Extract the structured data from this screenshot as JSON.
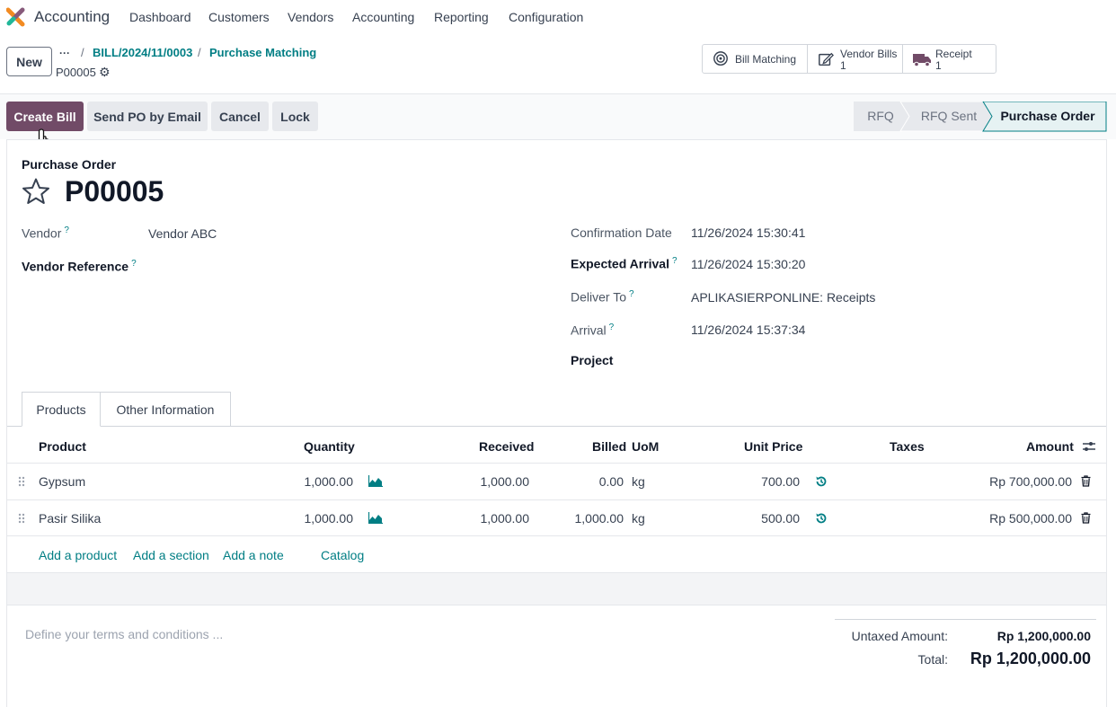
{
  "navbar": {
    "app_name": "Accounting",
    "menu": [
      "Dashboard",
      "Customers",
      "Vendors",
      "Accounting",
      "Reporting",
      "Configuration"
    ]
  },
  "control_panel": {
    "new_label": "New",
    "more_label": "···",
    "breadcrumbs": [
      "BILL/2024/11/0003",
      "Purchase Matching"
    ],
    "record_name": "P00005",
    "smart_buttons": [
      {
        "label": "Bill Matching",
        "value": "",
        "icon": "bullseye-icon"
      },
      {
        "label": "Vendor Bills",
        "value": "1",
        "icon": "pencil-square-icon"
      },
      {
        "label": "Receipt",
        "value": "1",
        "icon": "truck-icon"
      }
    ]
  },
  "actions": {
    "create_bill": "Create Bill",
    "send_po": "Send PO by Email",
    "cancel": "Cancel",
    "lock": "Lock"
  },
  "status_bar": {
    "stages": [
      "RFQ",
      "RFQ Sent",
      "Purchase Order"
    ],
    "active": "Purchase Order"
  },
  "form": {
    "type_label": "Purchase Order",
    "name": "P00005",
    "help_mark": "?",
    "vendor_label": "Vendor",
    "vendor_value": "Vendor ABC",
    "vendor_ref_label": "Vendor Reference",
    "confirmation_date_label": "Confirmation Date",
    "confirmation_date_value": "11/26/2024 15:30:41",
    "expected_arrival_label": "Expected Arrival",
    "expected_arrival_value": "11/26/2024 15:30:20",
    "deliver_to_label": "Deliver To",
    "deliver_to_value": "APLIKASIERPONLINE: Receipts",
    "arrival_label": "Arrival",
    "arrival_value": "11/26/2024 15:37:34",
    "project_label": "Project"
  },
  "tabs": [
    "Products",
    "Other Information"
  ],
  "table": {
    "headers": {
      "product": "Product",
      "quantity": "Quantity",
      "received": "Received",
      "billed": "Billed",
      "uom": "UoM",
      "unit_price": "Unit Price",
      "taxes": "Taxes",
      "amount": "Amount"
    },
    "rows": [
      {
        "product": "Gypsum",
        "quantity": "1,000.00",
        "received": "1,000.00",
        "billed": "0.00",
        "uom": "kg",
        "unit_price": "700.00",
        "taxes": "",
        "amount": "Rp 700,000.00"
      },
      {
        "product": "Pasir Silika",
        "quantity": "1,000.00",
        "received": "1,000.00",
        "billed": "1,000.00",
        "uom": "kg",
        "unit_price": "500.00",
        "taxes": "",
        "amount": "Rp 500,000.00"
      }
    ],
    "add_links": [
      "Add a product",
      "Add a section",
      "Add a note",
      "Catalog"
    ]
  },
  "footer": {
    "terms_placeholder": "Define your terms and conditions ...",
    "untaxed_label": "Untaxed Amount:",
    "untaxed_value": "Rp 1,200,000.00",
    "total_label": "Total:",
    "total_value": "Rp 1,200,000.00"
  },
  "colors": {
    "primary": "#714b67",
    "link": "#017e84",
    "logo_orange": "#f28b22",
    "logo_purple": "#875a7b",
    "logo_green": "#21b799"
  }
}
